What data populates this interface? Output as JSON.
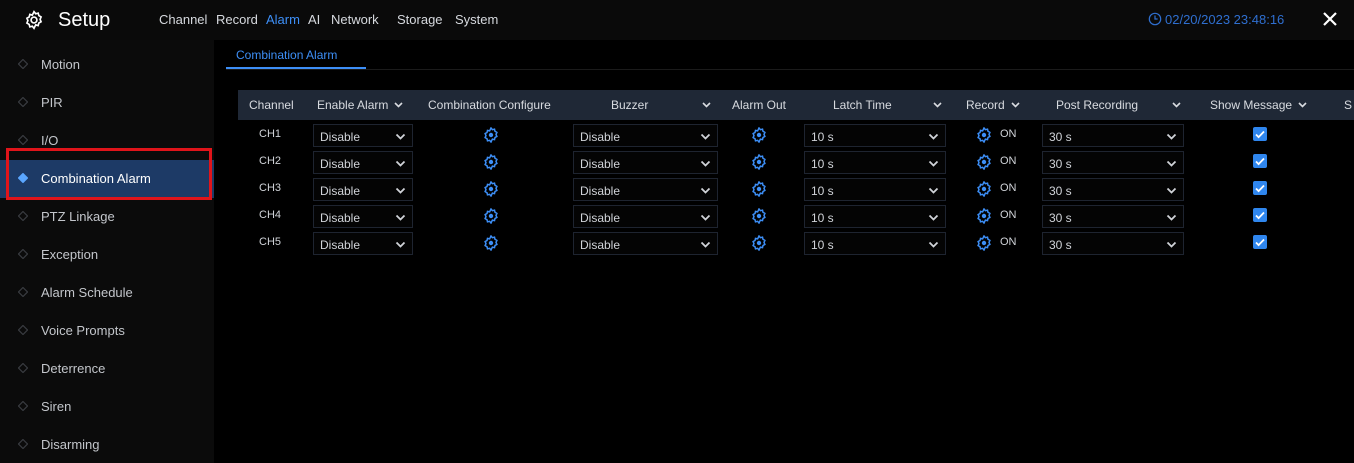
{
  "app": {
    "title": "Setup",
    "datetime": "02/20/2023 23:48:16"
  },
  "topnav": [
    "Channel",
    "Record",
    "Alarm",
    "AI",
    "Network",
    "Storage",
    "System"
  ],
  "topnav_active": "Alarm",
  "sidebar": {
    "items": [
      {
        "label": "Motion"
      },
      {
        "label": "PIR"
      },
      {
        "label": "I/O"
      },
      {
        "label": "Combination Alarm"
      },
      {
        "label": "PTZ Linkage"
      },
      {
        "label": "Exception"
      },
      {
        "label": "Alarm Schedule"
      },
      {
        "label": "Voice Prompts"
      },
      {
        "label": "Deterrence"
      },
      {
        "label": "Siren"
      },
      {
        "label": "Disarming"
      }
    ],
    "active": "Combination Alarm"
  },
  "subtab": "Combination Alarm",
  "table": {
    "headers": {
      "channel": "Channel",
      "enable_alarm": "Enable Alarm",
      "combination_configure": "Combination Configure",
      "buzzer": "Buzzer",
      "alarm_out": "Alarm Out",
      "latch_time": "Latch Time",
      "record": "Record",
      "post_recording": "Post Recording",
      "show_message": "Show Message",
      "overflow": "S"
    },
    "rows": [
      {
        "channel": "CH1",
        "enable_alarm": "Disable",
        "buzzer": "Disable",
        "latch_time": "10 s",
        "record": "ON",
        "post_recording": "30 s",
        "show_message": true
      },
      {
        "channel": "CH2",
        "enable_alarm": "Disable",
        "buzzer": "Disable",
        "latch_time": "10 s",
        "record": "ON",
        "post_recording": "30 s",
        "show_message": true
      },
      {
        "channel": "CH3",
        "enable_alarm": "Disable",
        "buzzer": "Disable",
        "latch_time": "10 s",
        "record": "ON",
        "post_recording": "30 s",
        "show_message": true
      },
      {
        "channel": "CH4",
        "enable_alarm": "Disable",
        "buzzer": "Disable",
        "latch_time": "10 s",
        "record": "ON",
        "post_recording": "30 s",
        "show_message": true
      },
      {
        "channel": "CH5",
        "enable_alarm": "Disable",
        "buzzer": "Disable",
        "latch_time": "10 s",
        "record": "ON",
        "post_recording": "30 s",
        "show_message": true
      }
    ]
  },
  "icons": {
    "logo": "gear-icon",
    "clock": "clock-icon",
    "close": "close-icon",
    "configure": "settings-gear-icon",
    "dropdown": "chevron-down-icon",
    "checkbox": "checkmark-icon",
    "sidebar_bullet": "diamond-icon"
  },
  "colors": {
    "accent": "#3d8ff7",
    "datetime": "#2f6fd0",
    "highlight_box": "#e0141a",
    "active_sidebar": "#1d3a66",
    "header_bg": "#1f2836"
  }
}
